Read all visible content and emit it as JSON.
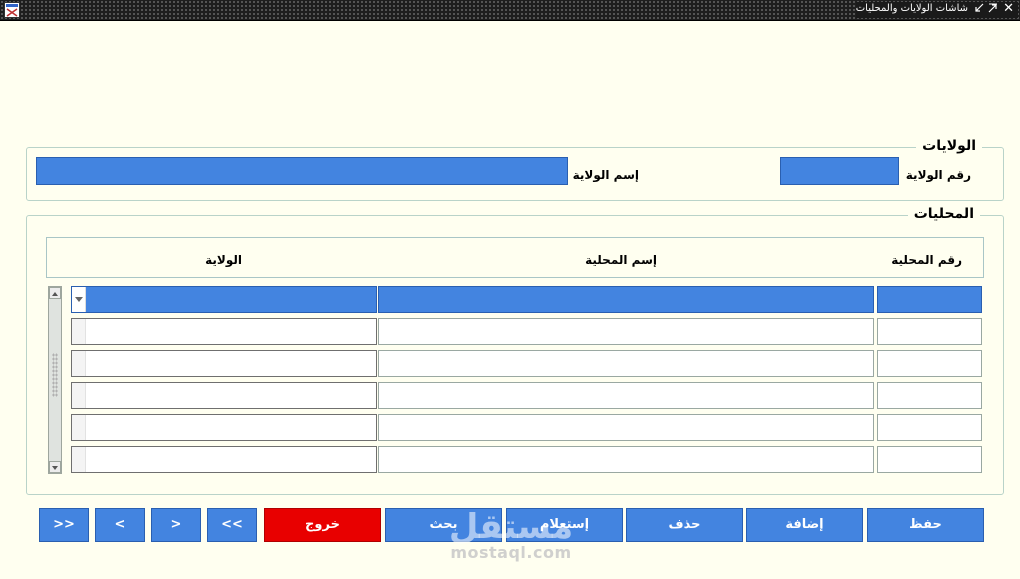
{
  "window": {
    "title": "شاشات الولايات والمحليات",
    "close_glyph": "✕"
  },
  "states_section": {
    "legend": "الولايات",
    "state_number_label": "رقم الولاية",
    "state_name_label": "إسم الولاية",
    "state_number_value": "",
    "state_name_value": ""
  },
  "localities_section": {
    "legend": "المحليات",
    "columns": [
      "رقم المحلية",
      "إسم المحلية",
      "الولاية"
    ],
    "rows": [
      {
        "number": "",
        "name": "",
        "state": ""
      },
      {
        "number": "",
        "name": "",
        "state": ""
      },
      {
        "number": "",
        "name": "",
        "state": ""
      },
      {
        "number": "",
        "name": "",
        "state": ""
      },
      {
        "number": "",
        "name": "",
        "state": ""
      },
      {
        "number": "",
        "name": "",
        "state": ""
      }
    ]
  },
  "buttons": {
    "save": "حفظ",
    "add": "إضافة",
    "delete": "حذف",
    "query": "إستعلام",
    "search": "بحث",
    "exit": "خروج",
    "prev_page": "<<",
    "prev": "<",
    "next": ">",
    "next_page": ">>"
  },
  "watermark": {
    "arabic": "مستقل",
    "latin": "mostaql.com"
  },
  "colors": {
    "background": "#fffff0",
    "field_blue": "#4384e0",
    "exit_red": "#e80000",
    "frame_border": "#b9d3c9"
  },
  "icons": [
    "app-icon",
    "close-icon",
    "maximize-icon",
    "minimize-icon",
    "chevron-down-icon",
    "scroll-up-icon",
    "scroll-down-icon"
  ]
}
